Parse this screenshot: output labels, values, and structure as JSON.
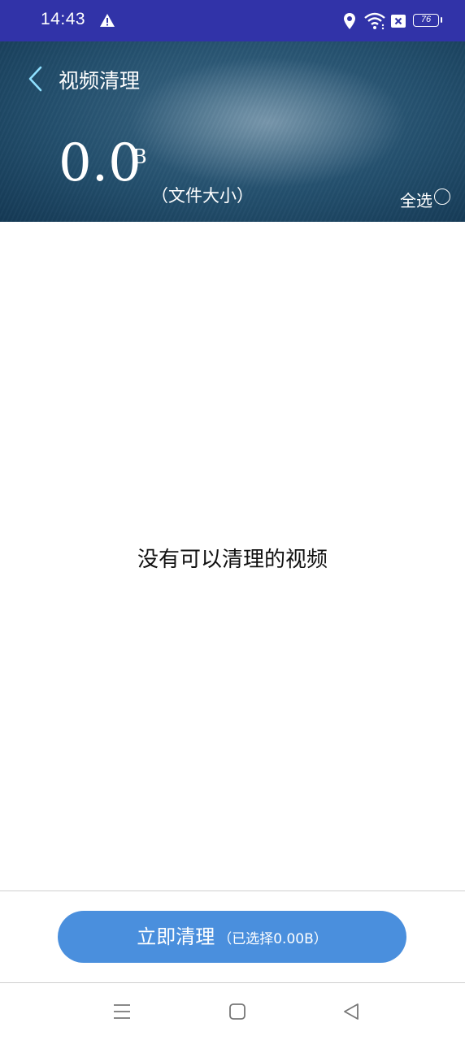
{
  "status_bar": {
    "time": "14:43",
    "battery": "76",
    "icons": [
      "warning-icon",
      "location-icon",
      "wifi-icon",
      "close-box-icon",
      "battery-icon"
    ]
  },
  "header": {
    "title": "视频清理",
    "size_value": "0.0",
    "size_unit": "B",
    "size_caption": "（文件大小）",
    "select_all_label": "全选",
    "select_all_checked": false
  },
  "content": {
    "empty_message": "没有可以清理的视频"
  },
  "action": {
    "clean_label": "立即清理",
    "selected_text": "（已选择0.00B）"
  },
  "nav_bar": {
    "icons": [
      "menu-icon",
      "home-icon",
      "back-icon"
    ]
  },
  "colors": {
    "status_bar": "#3133a8",
    "button": "#4a8fdd",
    "header_dark": "#153a56"
  }
}
